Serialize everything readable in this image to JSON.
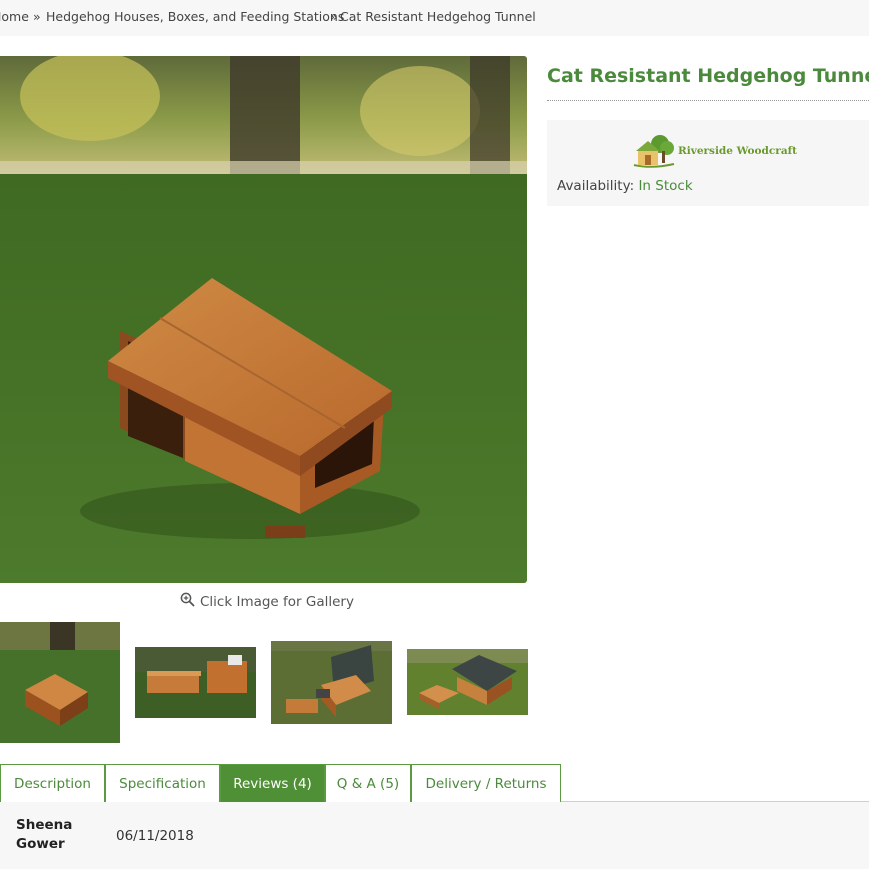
{
  "breadcrumb": {
    "home": "Home",
    "sep1": "»",
    "category": "Hedgehog Houses, Boxes, and Feeding Stations",
    "sep2": "»",
    "current": "Cat Resistant Hedgehog Tunnel"
  },
  "product": {
    "title": "Cat Resistant Hedgehog Tunnel",
    "gallery_hint": "Click Image for Gallery",
    "brand": "Riverside Woodcraft",
    "availability_label": "Availability:",
    "availability_value": "In Stock"
  },
  "tabs": [
    {
      "label": "Description",
      "active": false
    },
    {
      "label": "Specification",
      "active": false
    },
    {
      "label": "Reviews (4)",
      "active": true
    },
    {
      "label": "Q & A (5)",
      "active": false
    },
    {
      "label": "Delivery / Returns",
      "active": false
    }
  ],
  "review": {
    "name_line1": "Sheena",
    "name_line2": "Gower",
    "date": "06/11/2018"
  },
  "colors": {
    "brand_green": "#4b8a3c",
    "active_tab": "#4f8f35"
  },
  "icons": {
    "zoom": "zoom-in-icon",
    "brand": "riverside-woodcraft-logo"
  }
}
